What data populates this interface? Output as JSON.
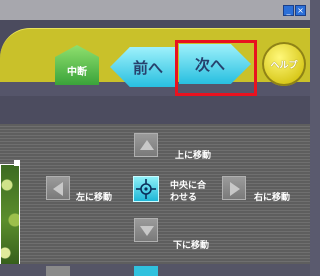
{
  "window": {
    "minimize_glyph": "_",
    "close_glyph": "×"
  },
  "toolbar": {
    "stop_label": "中断",
    "prev_label": "前へ",
    "next_label": "次へ",
    "help_label": "ヘルプ"
  },
  "move_panel": {
    "up_label": "上に移動",
    "down_label": "下に移動",
    "left_label": "左に移動",
    "right_label": "右に移動",
    "center_label_line1": "中央に合",
    "center_label_line2": "わせる"
  },
  "colors": {
    "toolbar_yellow": "#c9c12a",
    "nav_cyan": "#28bfe0",
    "stop_green": "#3aa33a",
    "highlight_red": "#e8121f"
  },
  "icons": {
    "center": "crosshair-icon",
    "up": "arrow-up-icon",
    "down": "arrow-down-icon",
    "left": "arrow-left-icon",
    "right": "arrow-right-icon"
  }
}
